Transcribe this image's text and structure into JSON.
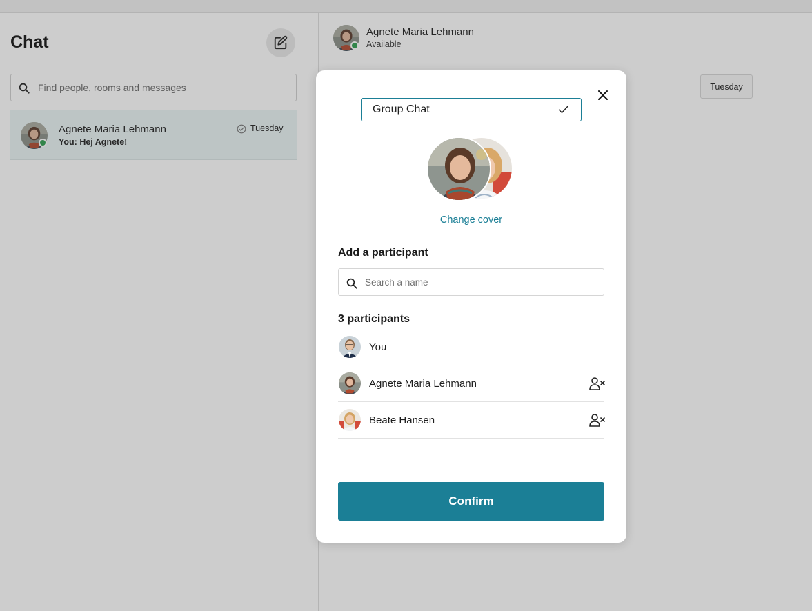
{
  "sidebar": {
    "title": "Chat",
    "search_placeholder": "Find people, rooms and messages",
    "conversations": [
      {
        "name": "Agnete Maria Lehmann",
        "preview": "You: Hej Agnete!",
        "date": "Tuesday",
        "online": true
      }
    ]
  },
  "main": {
    "header": {
      "name": "Agnete Maria Lehmann",
      "status": "Available"
    },
    "date_separator": "Tuesday"
  },
  "modal": {
    "group_name": "Group Chat",
    "change_cover_label": "Change cover",
    "add_participant_title": "Add a participant",
    "search_placeholder": "Search a name",
    "participants_title": "3 participants",
    "participants": [
      {
        "name": "You",
        "removable": false
      },
      {
        "name": "Agnete Maria Lehmann",
        "removable": true
      },
      {
        "name": "Beate Hansen",
        "removable": true
      }
    ],
    "confirm_label": "Confirm"
  },
  "colors": {
    "accent": "#1b7f96",
    "online": "#2e9e4f",
    "selected_row": "#eaf4f5"
  }
}
